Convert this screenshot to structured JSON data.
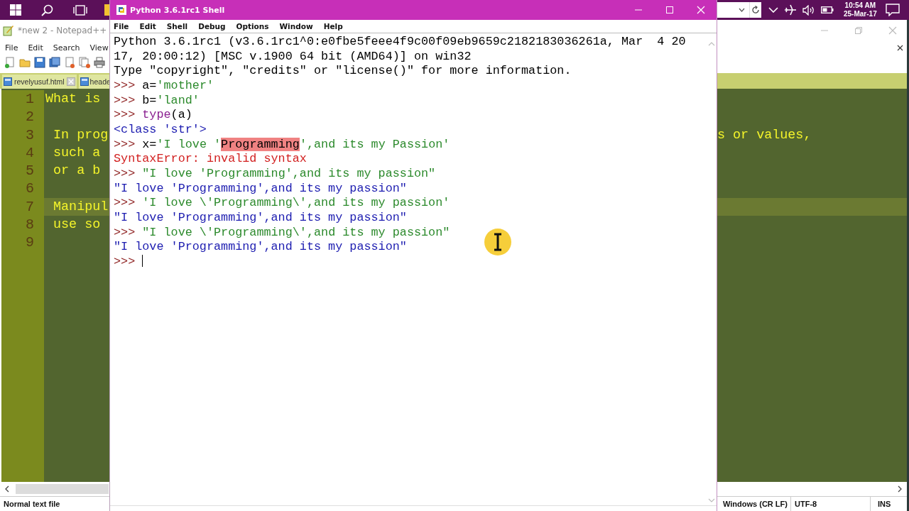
{
  "taskbar": {
    "clock": {
      "time": "10:54 AM",
      "date": "25-Mar-17"
    }
  },
  "notepad": {
    "title": "*new 2 - Notepad++",
    "menu": [
      "File",
      "Edit",
      "Search",
      "View"
    ],
    "tabs": [
      {
        "label": "revelyusuf.html",
        "has_close": true
      },
      {
        "label": "heade",
        "has_close": false
      }
    ],
    "lines": [
      {
        "number": "1",
        "text": "What is",
        "current": false
      },
      {
        "number": "2",
        "current": false
      },
      {
        "number": "3",
        "text": " In prog",
        "text_right": "s or values,",
        "current": false
      },
      {
        "number": "4",
        "text": " such a",
        "current": false
      },
      {
        "number": "5",
        "text": " or a b",
        "current": false
      },
      {
        "number": "6",
        "current": false
      },
      {
        "number": "7",
        "text": " Manipul",
        "current": true
      },
      {
        "number": "8",
        "text": " use so",
        "current": false
      },
      {
        "number": "9",
        "current": false
      }
    ],
    "status_bar": [
      "Normal text file",
      "Windows (CR LF)",
      "UTF-8",
      "INS"
    ]
  },
  "shell": {
    "title": "Python 3.6.1rc1 Shell",
    "menu": [
      "File",
      "Edit",
      "Shell",
      "Debug",
      "Options",
      "Window",
      "Help"
    ],
    "lines": [
      {
        "segments": [
          {
            "kind": "text",
            "text": "Python 3.6.1rc1 (v3.6.1rc1^0:e0fbe5feee4f9c00f09eb9659c2182183036261a, Mar  4 20"
          }
        ]
      },
      {
        "segments": [
          {
            "kind": "text",
            "text": "17, 20:00:12) [MSC v.1900 64 bit (AMD64)] on win32"
          }
        ]
      },
      {
        "segments": [
          {
            "kind": "text",
            "text": "Type \"copyright\", \"credits\" or \"license()\" for more information."
          }
        ]
      },
      {
        "segments": [
          {
            "kind": "prompt",
            "text": ">>> "
          },
          {
            "kind": "code",
            "text": "a="
          },
          {
            "kind": "string",
            "text": "'mother'"
          }
        ]
      },
      {
        "segments": [
          {
            "kind": "prompt",
            "text": ">>> "
          },
          {
            "kind": "code",
            "text": "b="
          },
          {
            "kind": "string",
            "text": "'land'"
          }
        ]
      },
      {
        "segments": [
          {
            "kind": "prompt",
            "text": ">>> "
          },
          {
            "kind": "builtin",
            "text": "type"
          },
          {
            "kind": "code",
            "text": "(a)"
          }
        ]
      },
      {
        "segments": [
          {
            "kind": "output",
            "text": "<class 'str'>"
          }
        ]
      },
      {
        "segments": [
          {
            "kind": "prompt",
            "text": ">>> "
          },
          {
            "kind": "code",
            "text": "x="
          },
          {
            "kind": "string",
            "text": "'I love '"
          },
          {
            "kind": "highlight",
            "text": "Programming"
          },
          {
            "kind": "string",
            "text": "',and its my Passion'"
          }
        ]
      },
      {
        "segments": [
          {
            "kind": "error",
            "text": "SyntaxError: invalid syntax"
          }
        ]
      },
      {
        "segments": [
          {
            "kind": "prompt",
            "text": ">>> "
          },
          {
            "kind": "string",
            "text": "\"I love 'Programming',and its my passion\""
          }
        ]
      },
      {
        "segments": [
          {
            "kind": "output",
            "text": "\"I love 'Programming',and its my passion\""
          }
        ]
      },
      {
        "segments": [
          {
            "kind": "prompt",
            "text": ">>> "
          },
          {
            "kind": "string",
            "text": "'I love \\'Programming\\',and its my passion'"
          }
        ]
      },
      {
        "segments": [
          {
            "kind": "output",
            "text": "\"I love 'Programming',and its my passion\""
          }
        ]
      },
      {
        "segments": [
          {
            "kind": "prompt",
            "text": ">>> "
          },
          {
            "kind": "string",
            "text": "\"I love \\'Programming\\',and its my passion\""
          }
        ]
      },
      {
        "segments": [
          {
            "kind": "output",
            "text": "\"I love 'Programming',and its my passion\""
          }
        ]
      },
      {
        "segments": [
          {
            "kind": "prompt",
            "text": ">>> "
          }
        ],
        "caret": true
      }
    ]
  }
}
